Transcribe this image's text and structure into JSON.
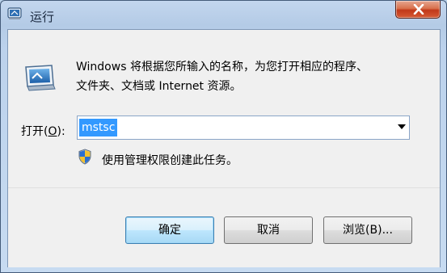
{
  "window": {
    "title": "运行"
  },
  "description": {
    "line1": "Windows 将根据您所输入的名称，为您打开相应的程序、",
    "line2": "文件夹、文档或 Internet 资源。"
  },
  "open_field": {
    "label_prefix": "打开(",
    "label_accel": "O",
    "label_suffix": "):",
    "value": "mstsc"
  },
  "admin_note": "使用管理权限创建此任务。",
  "buttons": {
    "ok": "确定",
    "cancel": "取消",
    "browse": "浏览(B)..."
  },
  "icons": {
    "title": "run-icon",
    "main": "run-dialog-icon",
    "shield": "uac-shield-icon",
    "close": "close-icon",
    "dropdown": "dropdown-arrow-icon"
  }
}
